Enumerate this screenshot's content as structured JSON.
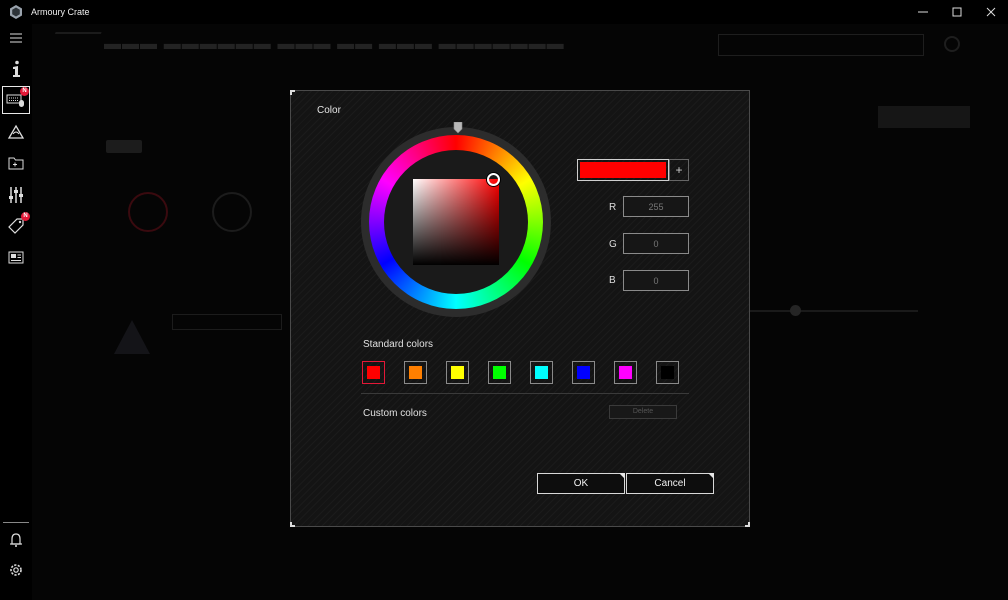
{
  "window": {
    "title": "Armoury Crate",
    "controls": [
      "minimize",
      "maximize",
      "close"
    ]
  },
  "sidebar": {
    "items": [
      {
        "name": "menu",
        "icon": "hamburger-menu-icon"
      },
      {
        "name": "info",
        "icon": "info-icon"
      },
      {
        "name": "device",
        "icon": "keyboard-mouse-icon",
        "badge": "N",
        "active": true
      },
      {
        "name": "aura",
        "icon": "aura-triangle-icon"
      },
      {
        "name": "armoury",
        "icon": "folder-gamepad-icon"
      },
      {
        "name": "tools",
        "icon": "sliders-icon"
      },
      {
        "name": "deals",
        "icon": "tag-icon",
        "badge": "N"
      },
      {
        "name": "news",
        "icon": "news-icon"
      },
      {
        "name": "user",
        "icon": "user-bell-icon"
      },
      {
        "name": "settings",
        "icon": "gear-icon"
      }
    ]
  },
  "dialog": {
    "title": "Color",
    "current_color": "#ff0000",
    "plus_label": "+",
    "rgb": {
      "r_label": "R",
      "r_value": "255",
      "g_label": "G",
      "g_value": "0",
      "b_label": "B",
      "b_value": "0"
    },
    "standard_colors_title": "Standard colors",
    "standard_colors": [
      "#ff0000",
      "#ff7f00",
      "#ffff00",
      "#00ff00",
      "#00ffff",
      "#0000ff",
      "#ff00ff",
      "#000000"
    ],
    "selected_standard_index": 0,
    "custom_colors_title": "Custom colors",
    "delete_label": "Delete",
    "ok_label": "OK",
    "cancel_label": "Cancel"
  },
  "colors": {
    "accent": "#e31837",
    "dialog_border": "#4a4a4a"
  }
}
